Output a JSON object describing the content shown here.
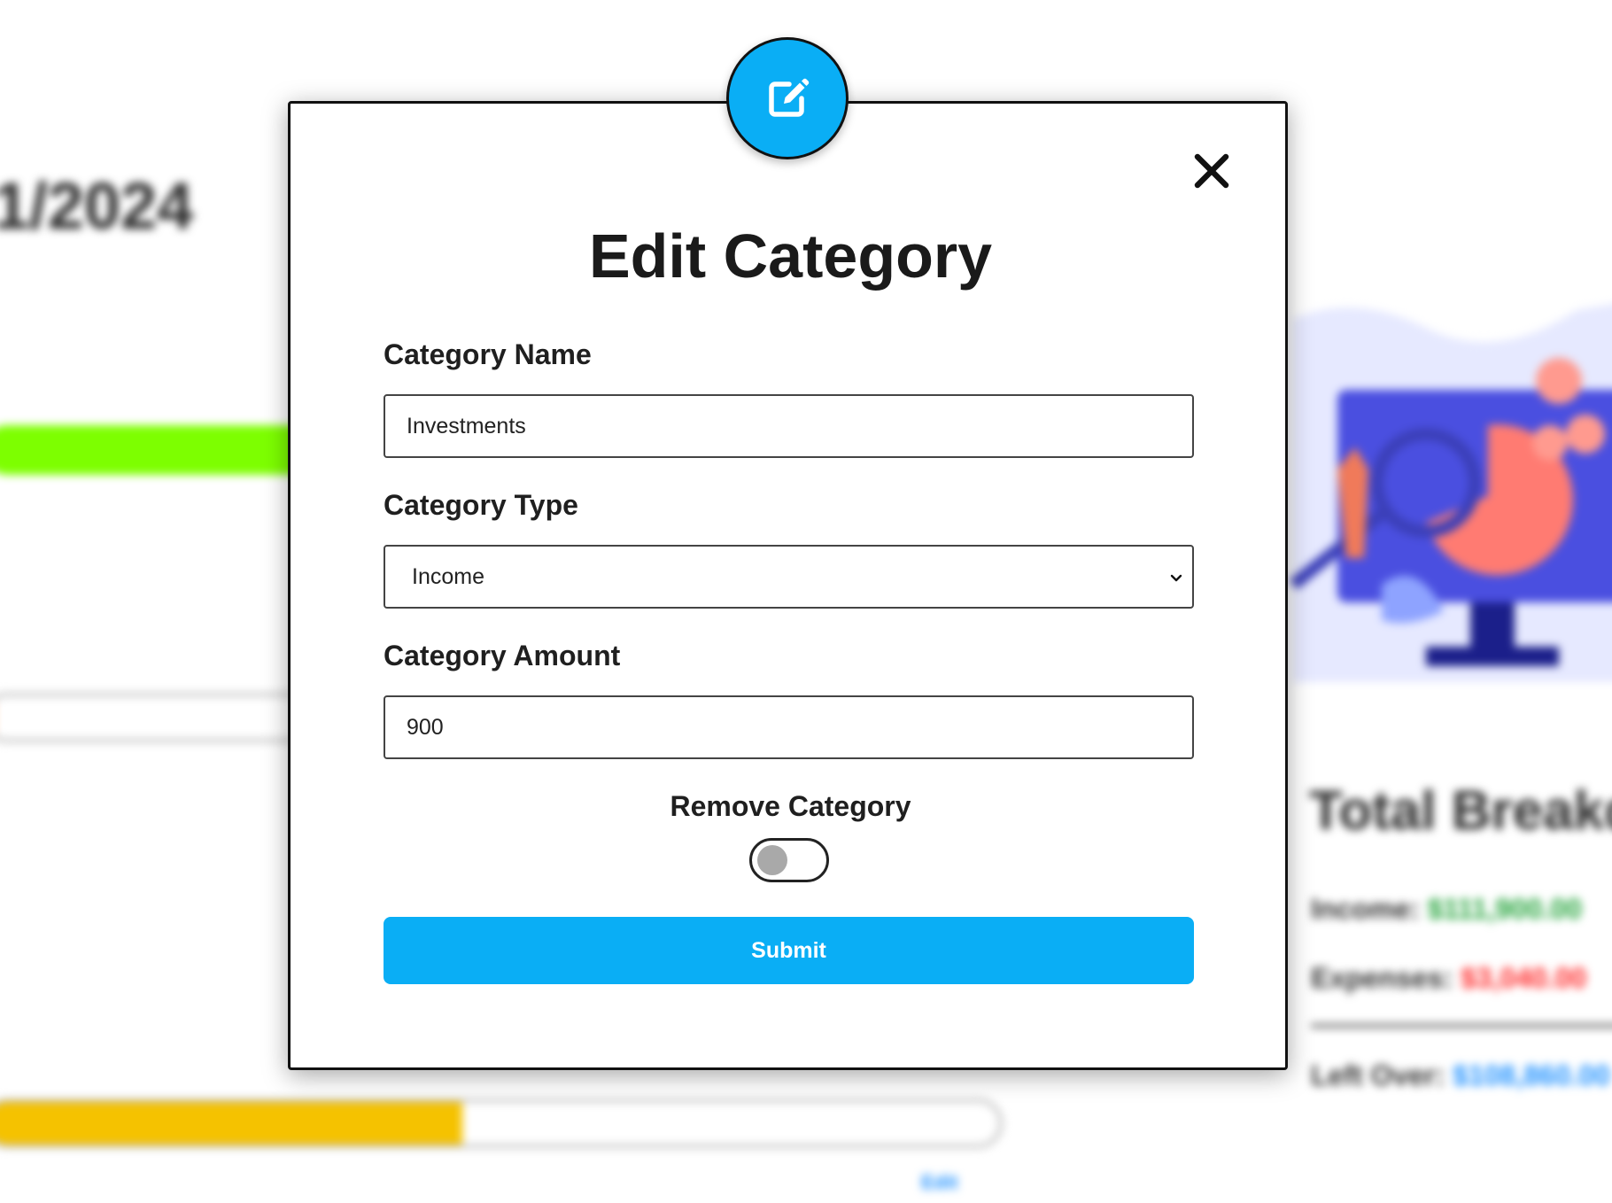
{
  "background": {
    "date_fragment": "1/2024",
    "progress_bars": [
      {
        "name": "green-progress",
        "fill_fraction": 1.0,
        "color": "#7dff00"
      },
      {
        "name": "orange-progress",
        "fill_fraction": 0.02,
        "color": "#ff6a00"
      },
      {
        "name": "yellow-progress",
        "fill_fraction": 0.47,
        "color": "#f5c200"
      }
    ],
    "edit_link": "Edit",
    "total_breakdown": {
      "title": "Total Breakdown",
      "income_label": "Income:",
      "income_value": "$111,900.00",
      "expenses_label": "Expenses:",
      "expenses_value": "$3,040.00",
      "left_over_label": "Left Over:",
      "left_over_value": "$108,860.00"
    }
  },
  "modal": {
    "badge_icon": "edit-icon",
    "close_icon": "close-icon",
    "title": "Edit Category",
    "category_name": {
      "label": "Category Name",
      "value": "Investments"
    },
    "category_type": {
      "label": "Category Type",
      "value": "Income"
    },
    "category_amount": {
      "label": "Category Amount",
      "value": "900"
    },
    "remove_category": {
      "label": "Remove Category",
      "checked": false
    },
    "submit_label": "Submit",
    "accent_color": "#0aaef5"
  }
}
